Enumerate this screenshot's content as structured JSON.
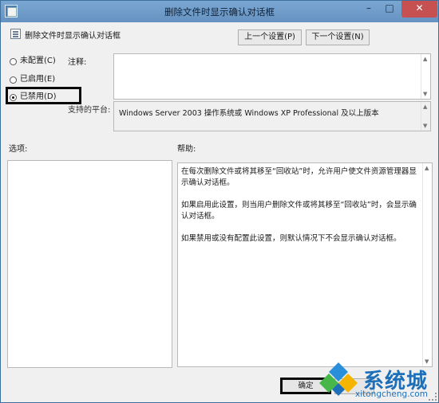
{
  "window": {
    "title": "删除文件时显示确认对话框",
    "controls": {
      "minimize": "–",
      "maximize": "□",
      "close": "✕"
    }
  },
  "policy": {
    "name": "删除文件时显示确认对话框",
    "prev_label": "上一个设置(P)",
    "next_label": "下一个设置(N)"
  },
  "state_options": [
    {
      "label": "未配置(C)",
      "checked": false
    },
    {
      "label": "已启用(E)",
      "checked": false
    },
    {
      "label": "已禁用(D)",
      "checked": true
    }
  ],
  "comment": {
    "label": "注释:",
    "value": ""
  },
  "supported": {
    "label": "支持的平台:",
    "value": "Windows Server 2003 操作系统或 Windows XP Professional 及以上版本"
  },
  "options": {
    "label": "选项:"
  },
  "help": {
    "label": "帮助:",
    "paragraphs": [
      "在每次删除文件或将其移至“回收站”时，允许用户使文件资源管理器显示确认对话框。",
      "如果启用此设置，则当用户删除文件或将其移至“回收站”时，会显示确认对话框。",
      "如果禁用或没有配置此设置，则默认情况下不会显示确认对话框。"
    ]
  },
  "buttons": {
    "ok_label": "确定",
    "cancel_label": ""
  },
  "watermark": {
    "brand": "系统城",
    "url": "xitongcheng.com"
  },
  "colors": {
    "titlebar": "#6f9ecb",
    "close_button": "#c75050",
    "watermark": "#1d6fb8"
  }
}
